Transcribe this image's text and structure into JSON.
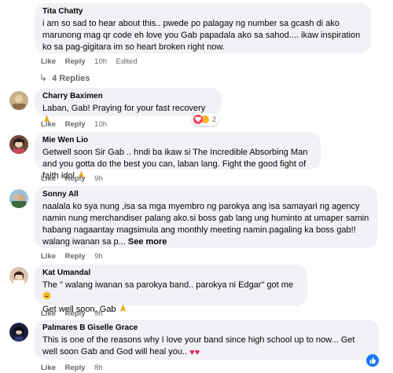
{
  "comments": [
    {
      "name": "Tita Chatty",
      "text": "i am so sad to hear about this.. pwede po palagay ng number sa gcash di ako marunong mag qr code eh love you Gab papadala ako sa sahod.... ikaw inspiration ko sa pag-gigitara im so heart broken right now.",
      "like": "Like",
      "reply": "Reply",
      "time": "10h",
      "edited": "Edited"
    },
    {
      "name": "Charry Baximen",
      "text": "Laban, Gab! Praying for your fast recovery",
      "like": "Like",
      "reply": "Reply",
      "time": "10h",
      "reaction_count": "2"
    },
    {
      "name": "Mie Wen Lio",
      "text": "Getwell soon Sir Gab .. hndi ba ikaw si The Incredible Absorbing Man and you gotta do the best you can, laban lang. Fight the good fight of faith idol",
      "like": "Like",
      "reply": "Reply",
      "time": "9h"
    },
    {
      "name": "Sonny All",
      "text": "naalala ko sya nung ,isa sa mga myembro ng parokya ang isa samayari ng agency namin nung merchandiser palang ako.si boss gab lang ung huminto at umaper samin habang nagaantay magsimula ang monthly meeting namin.pagaling ka boss gab!! walang iwanan sa p...",
      "see_more": "See more",
      "like": "Like",
      "reply": "Reply",
      "time": "9h"
    },
    {
      "name": "Kat Umandal",
      "text1": "The \" walang iwanan sa parokya band.. parokya ni Edgar\" got me",
      "text2": "Get well soon, Gab",
      "like": "Like",
      "reply": "Reply",
      "time": "9h"
    },
    {
      "name": "Palmares B Giselle Grace",
      "text": "This is one of the reasons why I love your band since high school up to now... Get well soon Gab and God will heal you..",
      "like": "Like",
      "reply": "Reply",
      "time": "8h"
    }
  ],
  "replies_label": "4 Replies",
  "colors": {
    "bubble": "#f0f2f5",
    "meta": "#65676b",
    "brand": "#1877f2"
  }
}
